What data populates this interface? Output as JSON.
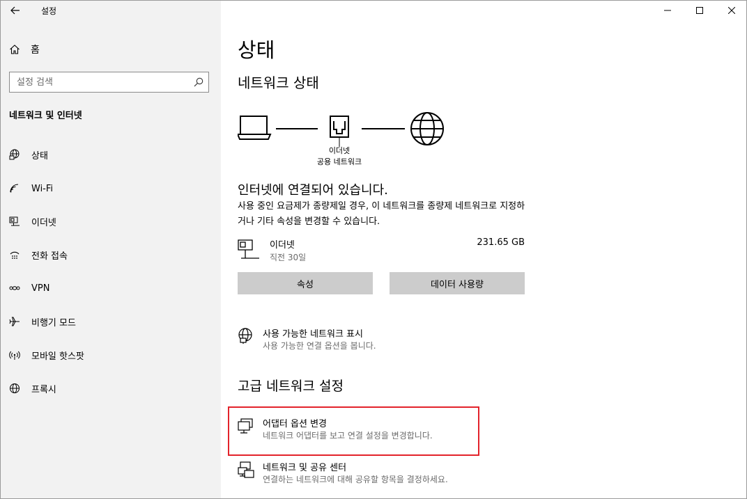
{
  "app": {
    "title": "설정"
  },
  "sidebar": {
    "home_label": "홈",
    "search_placeholder": "설정 검색",
    "section_title": "네트워크 및 인터넷",
    "items": [
      {
        "label": "상태",
        "icon": "status-globe-icon"
      },
      {
        "label": "Wi-Fi",
        "icon": "wifi-icon"
      },
      {
        "label": "이더넷",
        "icon": "ethernet-icon"
      },
      {
        "label": "전화 접속",
        "icon": "dialup-icon"
      },
      {
        "label": "VPN",
        "icon": "vpn-icon"
      },
      {
        "label": "비행기 모드",
        "icon": "airplane-icon"
      },
      {
        "label": "모바일 핫스팟",
        "icon": "hotspot-icon"
      },
      {
        "label": "프록시",
        "icon": "proxy-globe-icon"
      }
    ]
  },
  "main": {
    "page_title": "상태",
    "network_status_title": "네트워크 상태",
    "diagram": {
      "label_line1": "이더넷",
      "label_line2": "공용 네트워크"
    },
    "status_heading": "인터넷에 연결되어 있습니다.",
    "status_desc": "사용 중인 요금제가 종량제일 경우, 이 네트워크를 종량제 네트워크로 지정하거나 기타 속성을 변경할 수 있습니다.",
    "connection": {
      "name": "이더넷",
      "sub": "직전 30일",
      "usage": "231.65 GB"
    },
    "buttons": {
      "properties": "속성",
      "data_usage": "데이터 사용량"
    },
    "show_networks": {
      "title": "사용 가능한 네트워크 표시",
      "desc": "사용 가능한 연결 옵션을 봅니다."
    },
    "advanced_title": "고급 네트워크 설정",
    "adapter_options": {
      "title": "어댑터 옵션 변경",
      "desc": "네트워크 어댑터를 보고 연결 설정을 변경합니다."
    },
    "sharing_center": {
      "title": "네트워크 및 공유 센터",
      "desc": "연결하는 네트워크에 대해 공유할 항목을 결정하세요."
    }
  },
  "colors": {
    "sidebar_bg": "#f2f2f2",
    "button_bg": "#cccccc",
    "highlight_border": "#e3232b",
    "secondary_text": "#6b6b6b"
  }
}
